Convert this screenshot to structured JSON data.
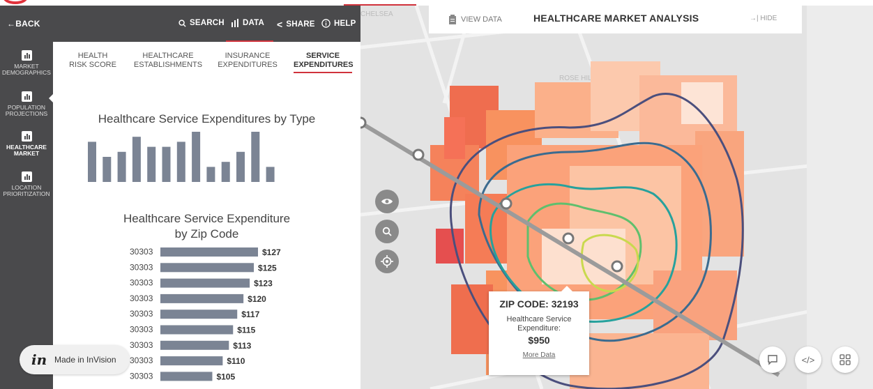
{
  "toolbar": {
    "back": "BACK",
    "search": "SEARCH",
    "data": "DATA",
    "share": "SHARE",
    "help": "HELP"
  },
  "sidebar": {
    "items": [
      {
        "label_line1": "MARKET",
        "label_line2": "DEMOGRAPHICS"
      },
      {
        "label_line1": "POPULATION",
        "label_line2": "PROJECTIONS"
      },
      {
        "label_line1": "HEALTHCARE",
        "label_line2": "MARKET"
      },
      {
        "label_line1": "LOCATION",
        "label_line2": "PRIORITIZATION"
      }
    ],
    "active_index": 2
  },
  "tabs": [
    {
      "line1": "HEALTH",
      "line2": "RISK SCORE"
    },
    {
      "line1": "HEALTHCARE",
      "line2": "ESTABLISHMENTS"
    },
    {
      "line1": "INSURANCE",
      "line2": "EXPENDITURES"
    },
    {
      "line1": "SERVICE",
      "line2": "EXPENDITURES"
    }
  ],
  "chart_data": [
    {
      "type": "bar",
      "title": "Healthcare Service Expenditures by Type",
      "values": [
        8,
        5,
        6,
        9,
        7,
        7,
        8,
        10,
        3,
        4,
        6,
        10,
        3
      ],
      "color": "#7b8494"
    },
    {
      "type": "bar",
      "orientation": "horizontal",
      "title_line1": "Healthcare Service Expenditure",
      "title_line2": "by Zip Code",
      "categories": [
        "30303",
        "30303",
        "30303",
        "30303",
        "30303",
        "30303",
        "30303",
        "30303",
        "30303"
      ],
      "values": [
        127,
        125,
        123,
        120,
        117,
        115,
        113,
        110,
        105
      ],
      "labels": [
        "$127",
        "$125",
        "$123",
        "$120",
        "$117",
        "$115",
        "$113",
        "$110",
        "$105"
      ],
      "color": "#7b8494"
    }
  ],
  "map": {
    "view_data": "VIEW DATA",
    "title": "HEALTHCARE MARKET ANALYSIS",
    "hide": "HIDE",
    "street_labels": [
      "ROSE HILL",
      "CHELSEA"
    ],
    "tooltip": {
      "title": "ZIP CODE: 32193",
      "label": "Healthcare Service Expenditure:",
      "value": "$950",
      "link": "More Data"
    }
  },
  "invision": {
    "logo": "in",
    "text": "Made in InVision"
  }
}
